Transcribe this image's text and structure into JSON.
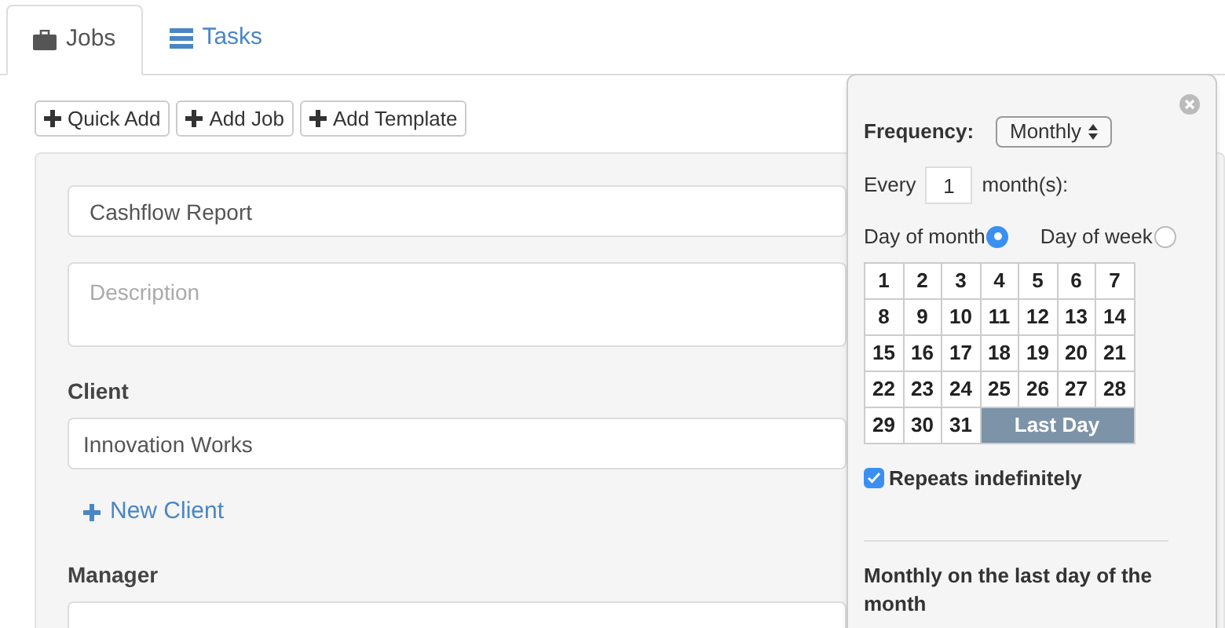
{
  "tabs": [
    {
      "label": "Jobs",
      "kind": "jobs",
      "selected": true
    },
    {
      "label": "Tasks",
      "kind": "tasks",
      "selected": false
    }
  ],
  "toolbar": [
    "Quick Add",
    "Add Job",
    "Add Template"
  ],
  "form": {
    "name_value": "Cashflow Report",
    "description_placeholder": "Description",
    "client_label": "Client",
    "client_value": "Innovation Works",
    "new_client": "New Client",
    "manager_label": "Manager"
  },
  "popover": {
    "frequency_label": "Frequency:",
    "frequency_value": "Monthly",
    "every_label": "Every",
    "every_value": "1",
    "unit_label": "month(s):",
    "modes": [
      {
        "label": "Day of month",
        "selected": true
      },
      {
        "label": "Day of week",
        "selected": false
      }
    ],
    "days": [
      {
        "label": "1",
        "kind": "day",
        "selected": false
      },
      {
        "label": "2",
        "kind": "day",
        "selected": false
      },
      {
        "label": "3",
        "kind": "day",
        "selected": false
      },
      {
        "label": "4",
        "kind": "day",
        "selected": false
      },
      {
        "label": "5",
        "kind": "day",
        "selected": false
      },
      {
        "label": "6",
        "kind": "day",
        "selected": false
      },
      {
        "label": "7",
        "kind": "day",
        "selected": false
      },
      {
        "label": "8",
        "kind": "day",
        "selected": false
      },
      {
        "label": "9",
        "kind": "day",
        "selected": false
      },
      {
        "label": "10",
        "kind": "day",
        "selected": false
      },
      {
        "label": "11",
        "kind": "day",
        "selected": false
      },
      {
        "label": "12",
        "kind": "day",
        "selected": false
      },
      {
        "label": "13",
        "kind": "day",
        "selected": false
      },
      {
        "label": "14",
        "kind": "day",
        "selected": false
      },
      {
        "label": "15",
        "kind": "day",
        "selected": false
      },
      {
        "label": "16",
        "kind": "day",
        "selected": false
      },
      {
        "label": "17",
        "kind": "day",
        "selected": false
      },
      {
        "label": "18",
        "kind": "day",
        "selected": false
      },
      {
        "label": "19",
        "kind": "day",
        "selected": false
      },
      {
        "label": "20",
        "kind": "day",
        "selected": false
      },
      {
        "label": "21",
        "kind": "day",
        "selected": false
      },
      {
        "label": "22",
        "kind": "day",
        "selected": false
      },
      {
        "label": "23",
        "kind": "day",
        "selected": false
      },
      {
        "label": "24",
        "kind": "day",
        "selected": false
      },
      {
        "label": "25",
        "kind": "day",
        "selected": false
      },
      {
        "label": "26",
        "kind": "day",
        "selected": false
      },
      {
        "label": "27",
        "kind": "day",
        "selected": false
      },
      {
        "label": "28",
        "kind": "day",
        "selected": false
      },
      {
        "label": "29",
        "kind": "day",
        "selected": false
      },
      {
        "label": "30",
        "kind": "day",
        "selected": false
      },
      {
        "label": "31",
        "kind": "day",
        "selected": false
      },
      {
        "label": "Last Day",
        "kind": "last",
        "selected": true
      }
    ],
    "repeats": {
      "label": "Repeats indefinitely",
      "checked": true
    },
    "summary": "Monthly on the last day of the month"
  }
}
